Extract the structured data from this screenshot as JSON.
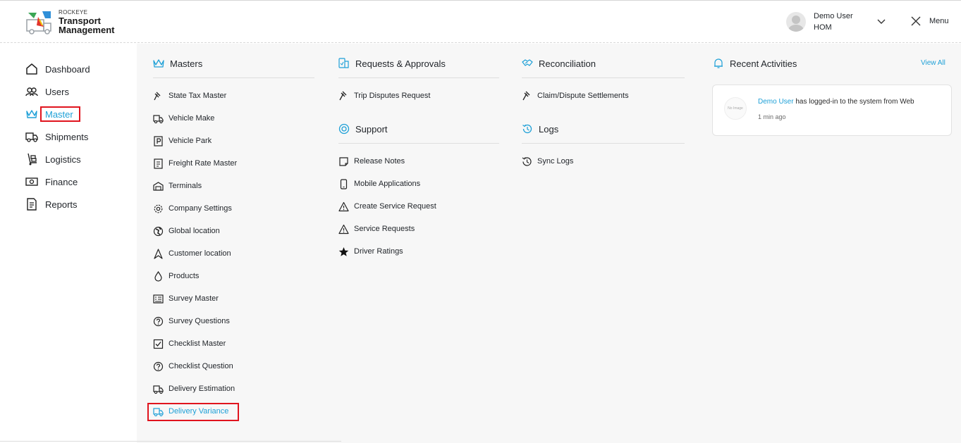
{
  "header": {
    "brand_small": "ROCKEYE",
    "brand_line1": "Transport",
    "brand_line2": "Management",
    "user_name": "Demo User",
    "user_role": "HOM",
    "menu_label": "Menu"
  },
  "sidebar": {
    "items": [
      {
        "label": "Dashboard",
        "icon": "home-icon"
      },
      {
        "label": "Users",
        "icon": "users-icon"
      },
      {
        "label": "Master",
        "icon": "crown-icon"
      },
      {
        "label": "Shipments",
        "icon": "truck-icon"
      },
      {
        "label": "Logistics",
        "icon": "hand-truck-icon"
      },
      {
        "label": "Finance",
        "icon": "cash-icon"
      },
      {
        "label": "Reports",
        "icon": "report-icon"
      }
    ],
    "active": "Master"
  },
  "masters": {
    "title": "Masters",
    "items": [
      "State Tax Master",
      "Vehicle Make",
      "Vehicle Park",
      "Freight Rate Master",
      "Terminals",
      "Company Settings",
      "Global location",
      "Customer location",
      "Products",
      "Survey Master",
      "Survey Questions",
      "Checklist Master",
      "Checklist Question",
      "Delivery Estimation",
      "Delivery Variance"
    ],
    "active": "Delivery Variance"
  },
  "requests": {
    "title": "Requests & Approvals",
    "items": [
      "Trip Disputes Request"
    ]
  },
  "support": {
    "title": "Support",
    "items": [
      "Release Notes",
      "Mobile Applications",
      "Create Service Request",
      "Service Requests",
      "Driver Ratings"
    ]
  },
  "reconciliation": {
    "title": "Reconciliation",
    "items": [
      "Claim/Dispute Settlements"
    ]
  },
  "logs": {
    "title": "Logs",
    "items": [
      "Sync Logs"
    ]
  },
  "recent": {
    "title": "Recent Activities",
    "view_all": "View All",
    "activity": {
      "no_image": "No Image",
      "who": "Demo User",
      "text": " has logged-in to the system from Web",
      "time": "1 min ago"
    }
  },
  "colors": {
    "accent": "#1ea0d7",
    "highlight": "#e0141e",
    "panel_bg": "#f7f7f7"
  }
}
